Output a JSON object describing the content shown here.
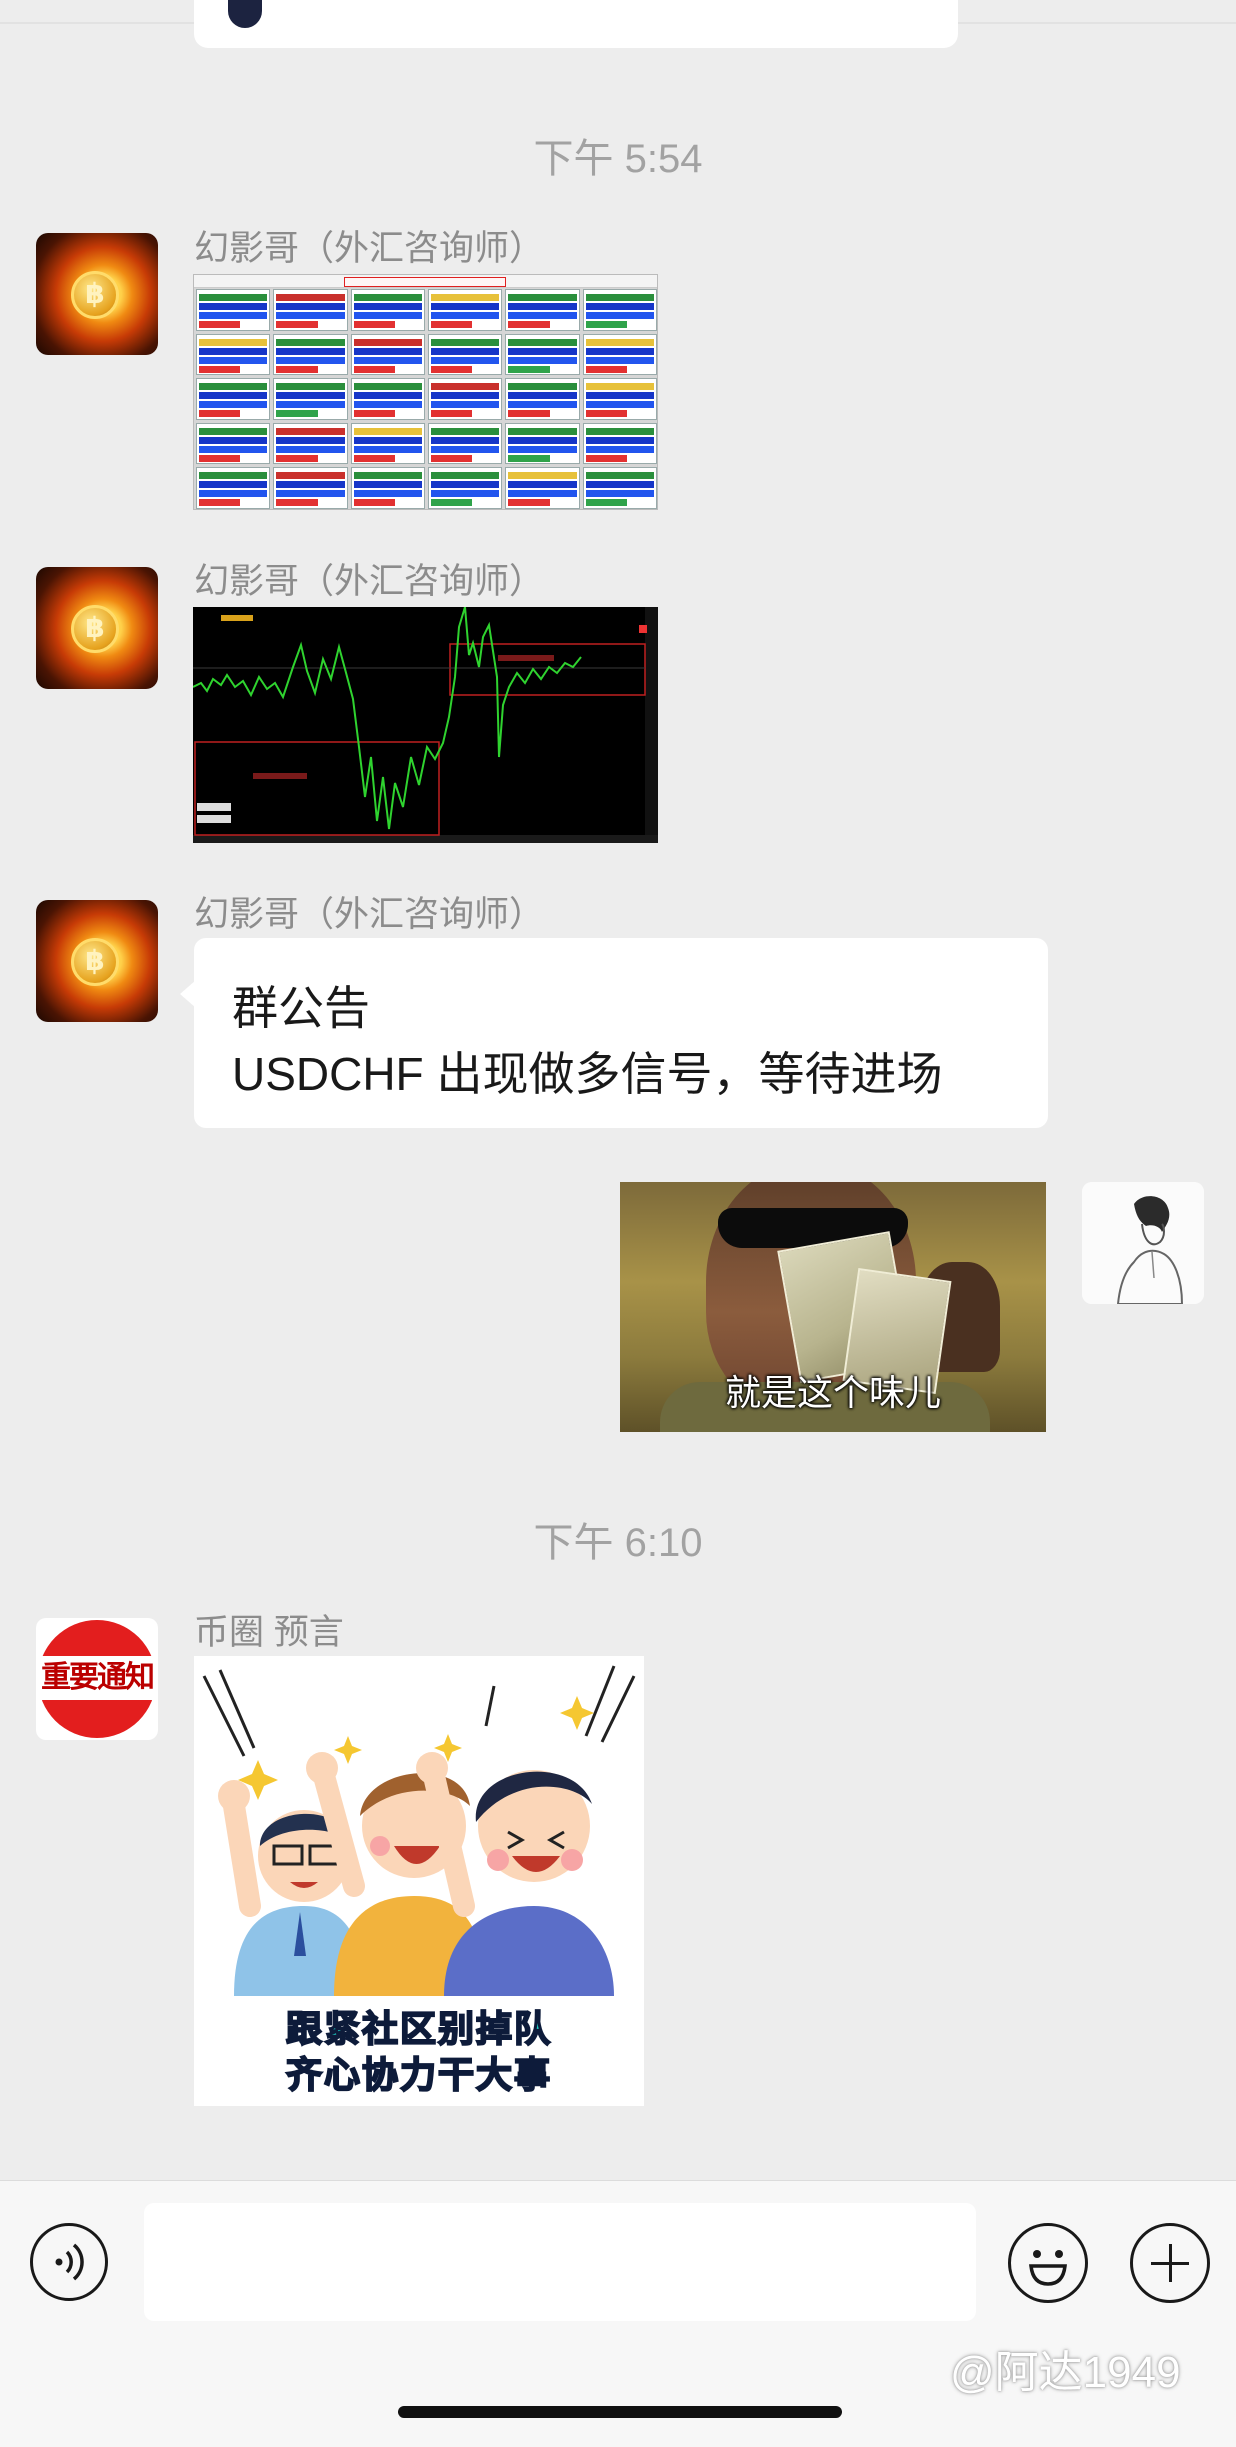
{
  "chat": {
    "timestamps": [
      "下午 5:54",
      "下午 6:10"
    ],
    "messages": [
      {
        "sender": "幻影哥（外汇咨询师）",
        "type": "image",
        "image": "trading-signal-dashboard-screenshot"
      },
      {
        "sender": "幻影哥（外汇咨询师）",
        "type": "image",
        "image": "forex-candlestick-chart-screenshot"
      },
      {
        "sender": "幻影哥（外汇咨询师）",
        "type": "text",
        "line1": "群公告",
        "line2": "USDCHF 出现做多信号，等待进场"
      },
      {
        "sender": "self",
        "type": "sticker",
        "caption": "就是这个味儿"
      },
      {
        "sender": "币圈 预言",
        "type": "image",
        "caption_line1": "跟紧社区别掉队",
        "caption_line2": "齐心协力干大事"
      }
    ]
  },
  "avatars": {
    "btc": "bitcoin-avatar",
    "notice_text": "重要通知",
    "self": "sketch-boy-avatar"
  },
  "input_bar": {
    "voice_icon": "voice-icon",
    "emoji_icon": "emoji-icon",
    "plus_icon": "plus-icon",
    "text_value": ""
  },
  "watermark": "@阿达1949",
  "colors": {
    "background": "#ededed",
    "bubble": "#ffffff",
    "timestamp": "#a2a2a2",
    "sender": "#8c8c8c"
  }
}
